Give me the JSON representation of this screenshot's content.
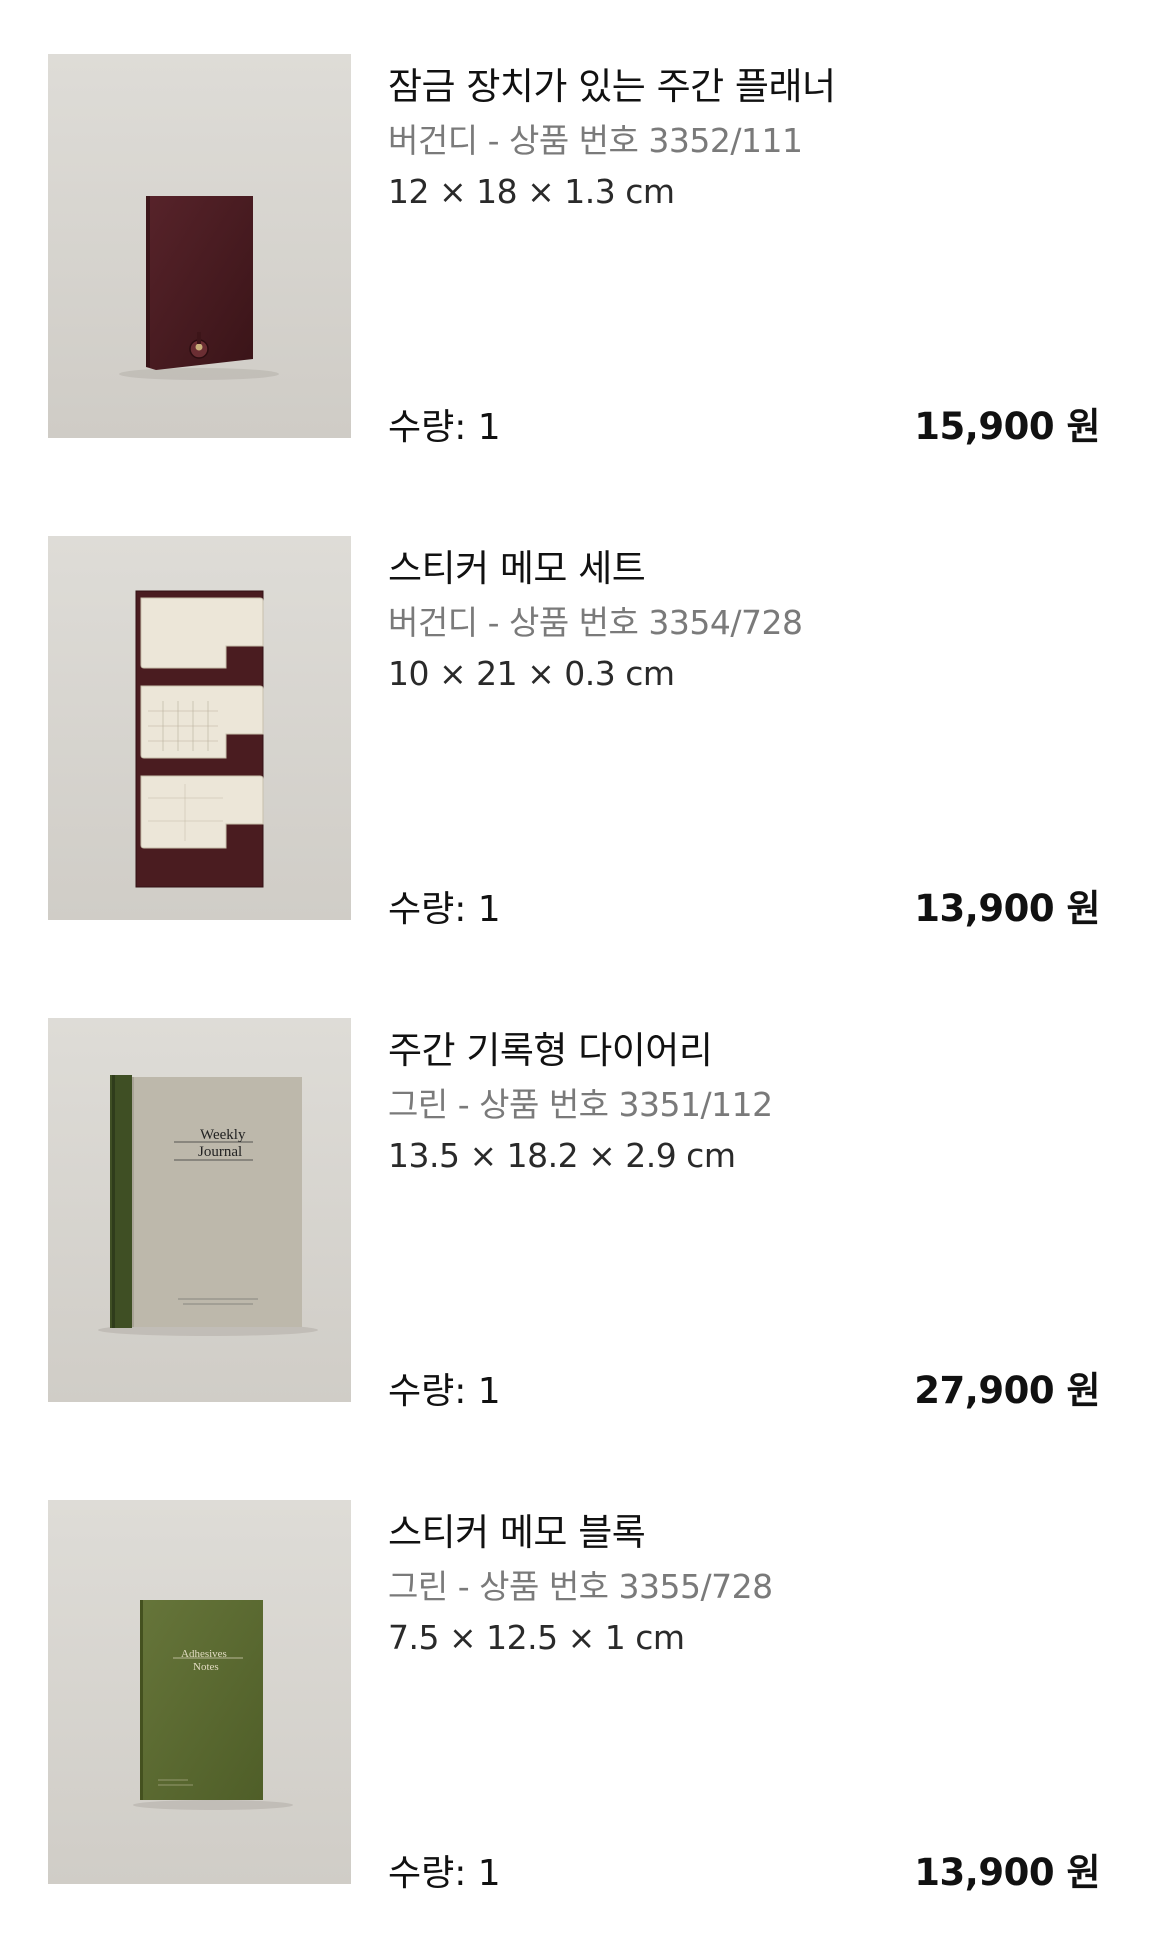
{
  "cart": {
    "items": [
      {
        "name": "잠금 장치가 있는 주간 플래너",
        "meta": "버건디 - 상품 번호 3352/111",
        "dims": "12 × 18 × 1.3 cm",
        "qty": "수량: 1",
        "price": "15,900 원",
        "image": "burgundy-planner-image"
      },
      {
        "name": "스티커 메모 세트",
        "meta": "버건디 - 상품 번호 3354/728",
        "dims": "10 × 21 × 0.3 cm",
        "qty": "수량: 1",
        "price": "13,900 원",
        "image": "sticky-memo-set-image"
      },
      {
        "name": "주간 기록형 다이어리",
        "meta": "그린 - 상품 번호 3351/112",
        "dims": "13.5 × 18.2 × 2.9 cm",
        "qty": "수량: 1",
        "price": "27,900 원",
        "image": "weekly-journal-image",
        "cover_title_1": "Weekly",
        "cover_title_2": "Journal"
      },
      {
        "name": "스티커 메모 블록",
        "meta": "그린 - 상품 번호 3355/728",
        "dims": "7.5 × 12.5 × 1 cm",
        "qty": "수량: 1",
        "price": "13,900 원",
        "image": "adhesive-notes-image",
        "cover_title_1": "Adhesives",
        "cover_title_2": "Notes"
      }
    ]
  },
  "colors": {
    "burgundy": "#4a1c20",
    "green": "#5c6a30",
    "journal_spine": "#3f4f24",
    "journal_cover": "#bdb8ab",
    "price_text": "#111111",
    "meta_text": "#7a7a7a"
  }
}
